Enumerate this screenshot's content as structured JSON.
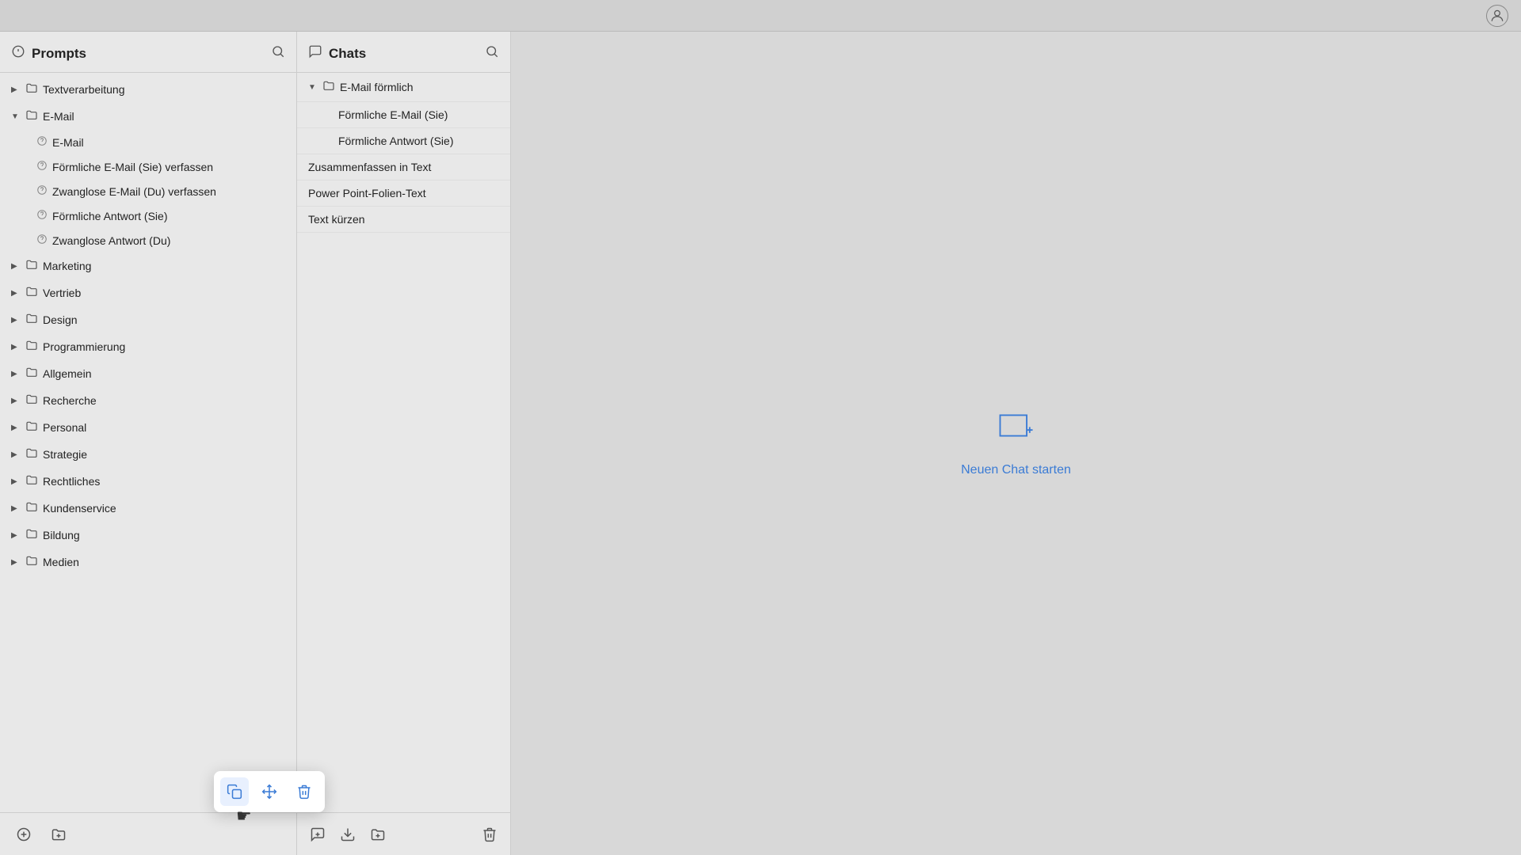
{
  "topbar": {
    "avatar_icon": "user-circle"
  },
  "prompts_panel": {
    "title": "Prompts",
    "title_icon": "lightbulb",
    "search_icon": "search",
    "items": [
      {
        "id": "textverarbeitung",
        "label": "Textverarbeitung",
        "type": "folder",
        "expanded": false,
        "level": 0
      },
      {
        "id": "email",
        "label": "E-Mail",
        "type": "folder",
        "expanded": true,
        "level": 0
      },
      {
        "id": "email-prompt",
        "label": "E-Mail",
        "type": "prompt",
        "level": 1
      },
      {
        "id": "foermliche-email",
        "label": "Förmliche E-Mail (Sie) verfassen",
        "type": "prompt",
        "level": 1
      },
      {
        "id": "zwanglose-email",
        "label": "Zwanglose E-Mail (Du) verfassen",
        "type": "prompt",
        "level": 1
      },
      {
        "id": "foermliche-antwort",
        "label": "Förmliche Antwort (Sie)",
        "type": "prompt",
        "level": 1
      },
      {
        "id": "zwanglose-antwort",
        "label": "Zwanglose Antwort (Du)",
        "type": "prompt",
        "level": 1
      },
      {
        "id": "marketing",
        "label": "Marketing",
        "type": "folder",
        "expanded": false,
        "level": 0
      },
      {
        "id": "vertrieb",
        "label": "Vertrieb",
        "type": "folder",
        "expanded": false,
        "level": 0
      },
      {
        "id": "design",
        "label": "Design",
        "type": "folder",
        "expanded": false,
        "level": 0
      },
      {
        "id": "programmierung",
        "label": "Programmierung",
        "type": "folder",
        "expanded": false,
        "level": 0
      },
      {
        "id": "allgemein",
        "label": "Allgemein",
        "type": "folder",
        "expanded": false,
        "level": 0
      },
      {
        "id": "recherche",
        "label": "Recherche",
        "type": "folder",
        "expanded": false,
        "level": 0
      },
      {
        "id": "personal",
        "label": "Personal",
        "type": "folder",
        "expanded": false,
        "level": 0
      },
      {
        "id": "strategie",
        "label": "Strategie",
        "type": "folder",
        "expanded": false,
        "level": 0
      },
      {
        "id": "rechtliches",
        "label": "Rechtliches",
        "type": "folder",
        "expanded": false,
        "level": 0
      },
      {
        "id": "kundenservice",
        "label": "Kundenservice",
        "type": "folder",
        "expanded": false,
        "level": 0
      },
      {
        "id": "bildung",
        "label": "Bildung",
        "type": "folder",
        "expanded": false,
        "level": 0
      },
      {
        "id": "medien",
        "label": "Medien",
        "type": "folder",
        "expanded": false,
        "level": 0
      }
    ],
    "toolbar": {
      "add_prompt_icon": "add-prompt",
      "add_folder_icon": "add-folder",
      "popup": {
        "copy_icon": "copy",
        "move_icon": "move",
        "delete_icon": "delete"
      }
    }
  },
  "chats_panel": {
    "title": "Chats",
    "title_icon": "chat-square",
    "search_icon": "search",
    "items": [
      {
        "id": "email-foermlich",
        "label": "E-Mail förmlich",
        "type": "folder",
        "expanded": true
      },
      {
        "id": "foermliche-email-sie",
        "label": "Förmliche E-Mail (Sie)",
        "type": "chat",
        "level": 1
      },
      {
        "id": "foermliche-antwort-sie",
        "label": "Förmliche Antwort (Sie)",
        "type": "chat",
        "level": 1
      },
      {
        "id": "zusammenfassen",
        "label": "Zusammenfassen in Text",
        "type": "chat",
        "level": 0
      },
      {
        "id": "powerpoint",
        "label": "Power Point-Folien-Text",
        "type": "chat",
        "level": 0
      },
      {
        "id": "text-kuerzen",
        "label": "Text kürzen",
        "type": "chat",
        "level": 0
      }
    ],
    "toolbar": {
      "add_chat_icon": "add-chat",
      "import_icon": "import",
      "add_folder_icon": "add-folder",
      "delete_icon": "delete"
    }
  },
  "main_area": {
    "new_chat_label": "Neuen Chat starten",
    "new_chat_icon": "chat-plus"
  }
}
